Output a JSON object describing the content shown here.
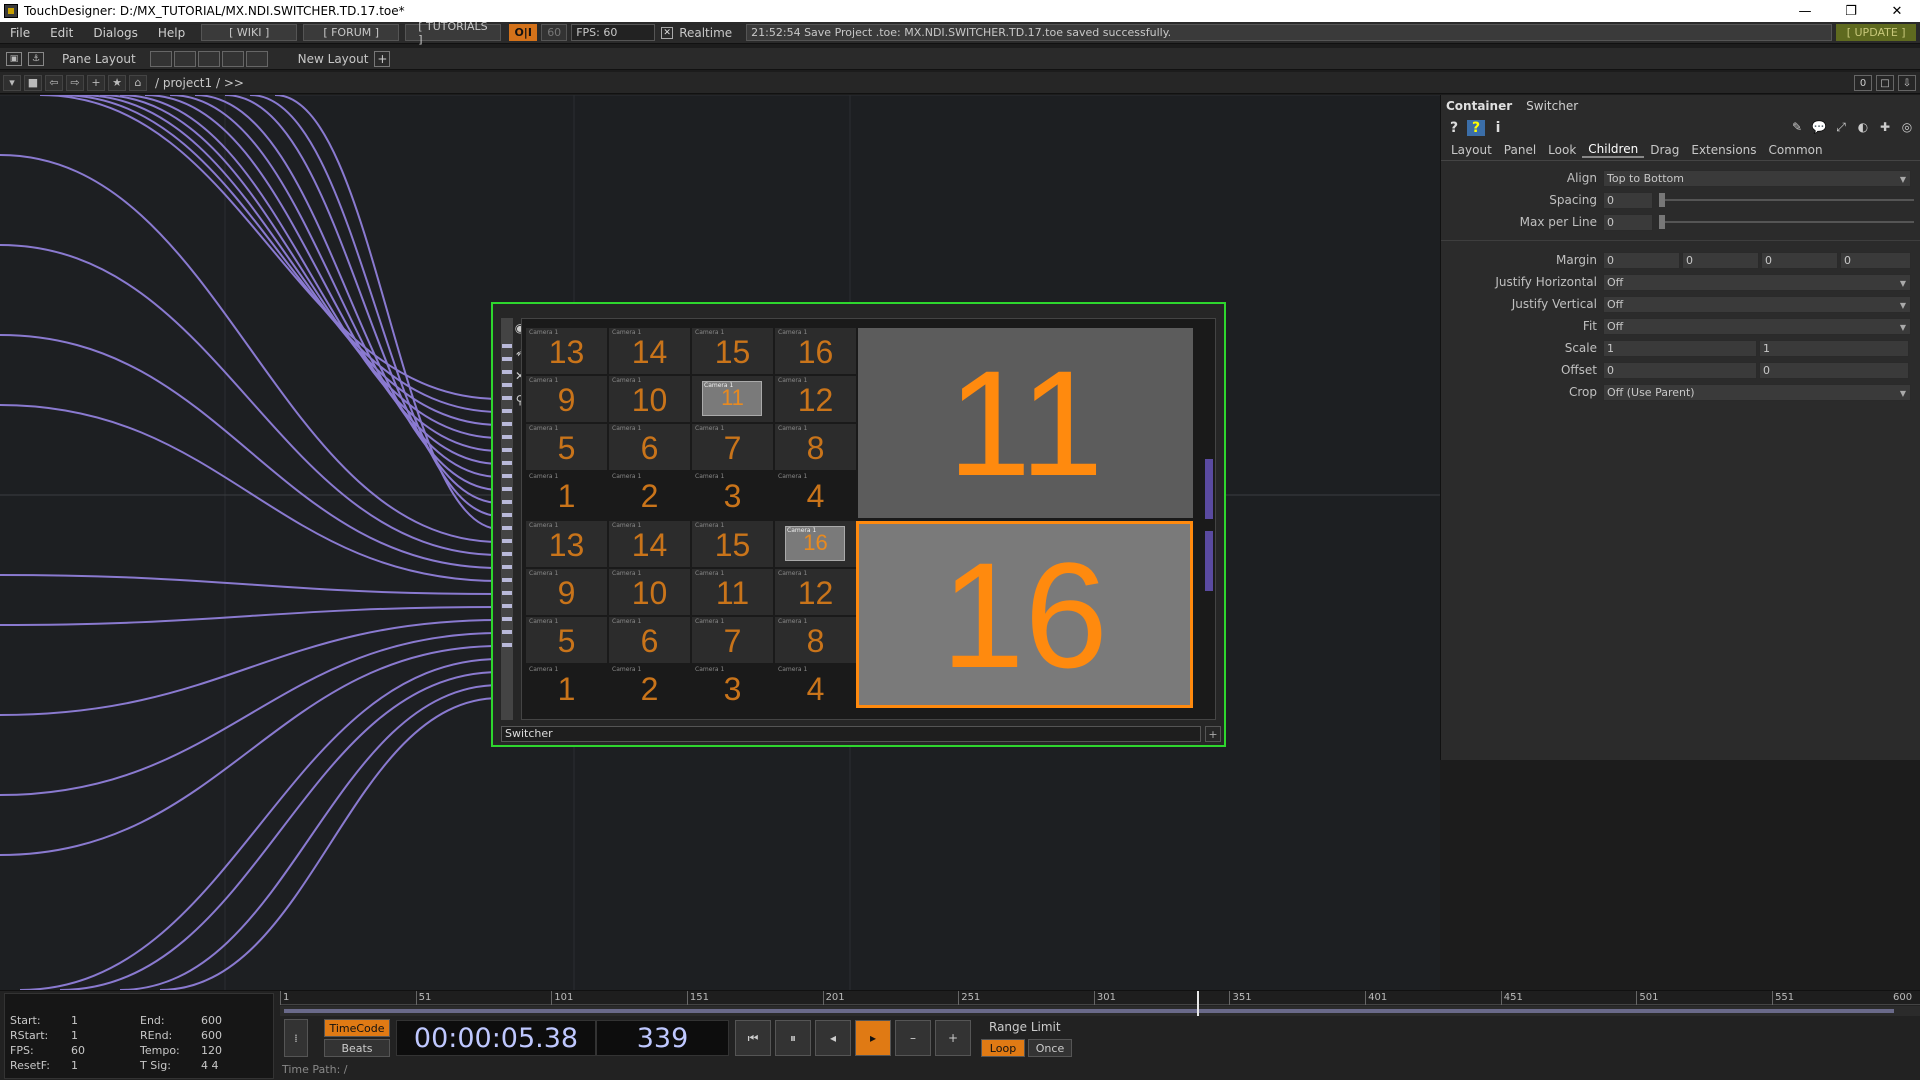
{
  "window": {
    "title": "TouchDesigner: D:/MX_TUTORIAL/MX.NDI.SWITCHER.TD.17.toe*",
    "controls": [
      "—",
      "❐",
      "✕"
    ]
  },
  "menubar": {
    "menus": [
      "File",
      "Edit",
      "Dialogs",
      "Help"
    ],
    "wiki": "[ WIKI ]",
    "forum": "[ FORUM ]",
    "tutorials": "[ TUTORIALS ]",
    "oi": "O|I",
    "fps_box": "60",
    "fps_label": "FPS:  60",
    "realtime_check": "✕",
    "realtime": "Realtime",
    "status": "21:52:54 Save Project .toe: MX.NDI.SWITCHER.TD.17.toe saved successfully.",
    "update": "[ UPDATE ]"
  },
  "toolbar": {
    "pane_layout": "Pane Layout",
    "new_layout": "New Layout",
    "plus": "+"
  },
  "pathbar": {
    "path": "/ project1 / >>",
    "right_buttons": [
      "0",
      "□",
      "⇩"
    ]
  },
  "node": {
    "label": "Switcher",
    "plus": "+",
    "cam_label": "Camera 1",
    "top_grid": [
      13,
      14,
      15,
      16,
      9,
      10,
      11,
      12,
      5,
      6,
      7,
      8,
      1,
      2,
      3,
      4
    ],
    "top_selected": "11",
    "top_big": "11",
    "bottom_grid": [
      13,
      14,
      15,
      16,
      9,
      10,
      11,
      12,
      5,
      6,
      7,
      8,
      1,
      2,
      3,
      4
    ],
    "bottom_selected": "16",
    "bottom_big": "16"
  },
  "params": {
    "op_type": "Container",
    "op_name": "Switcher",
    "tabs": [
      "Layout",
      "Panel",
      "Look",
      "Children",
      "Drag",
      "Extensions",
      "Common"
    ],
    "active_tab": "Children",
    "align_label": "Align",
    "align_value": "Top to Bottom",
    "spacing_label": "Spacing",
    "spacing_value": "0",
    "maxline_label": "Max per Line",
    "maxline_value": "0",
    "margin_label": "Margin",
    "margin_values": [
      "0",
      "0",
      "0",
      "0"
    ],
    "jh_label": "Justify Horizontal",
    "jh_value": "Off",
    "jv_label": "Justify Vertical",
    "jv_value": "Off",
    "fit_label": "Fit",
    "fit_value": "Off",
    "scale_label": "Scale",
    "scale_values": [
      "1",
      "1"
    ],
    "offset_label": "Offset",
    "offset_values": [
      "0",
      "0"
    ],
    "crop_label": "Crop",
    "crop_value": "Off (Use Parent)"
  },
  "timeline": {
    "start_label": "Start:",
    "start": "1",
    "end_label": "End:",
    "end": "600",
    "rstart_label": "RStart:",
    "rstart": "1",
    "rend_label": "REnd:",
    "rend": "600",
    "fps_label": "FPS:",
    "fps": "60",
    "tempo_label": "Tempo:",
    "tempo": "120",
    "resetf_label": "ResetF:",
    "resetf": "1",
    "tsig_label": "T Sig:",
    "tsig": "4    4",
    "ruler_ticks": [
      "1",
      "51",
      "101",
      "151",
      "201",
      "251",
      "301",
      "351",
      "401",
      "451",
      "501",
      "551",
      "600"
    ],
    "timecode_btn": "TimeCode",
    "beats_btn": "Beats",
    "timecode": "00:00:05.38",
    "frame": "339",
    "range_limit": "Range Limit",
    "loop": "Loop",
    "once": "Once",
    "time_path": "Time Path: /",
    "buttons": [
      "⏮",
      "⏸",
      "◂",
      "▸",
      "–",
      "+"
    ]
  },
  "colors": {
    "node_border": "#2ed62e",
    "accent_orange": "#ff8a0e",
    "wire": "#8a7ad0"
  }
}
